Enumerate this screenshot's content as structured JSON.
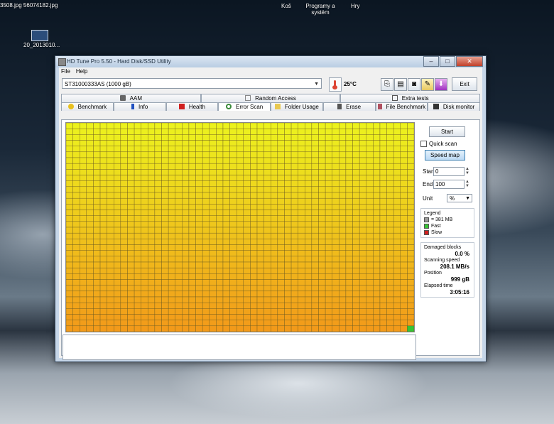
{
  "desktop": {
    "top_files": "3508.jpg   56074182.jpg",
    "top_items": [
      "Koš",
      "Programy a systém",
      "Hry"
    ],
    "icon_label": "20_2013010..."
  },
  "window": {
    "title": "HD Tune Pro 5.50 - Hard Disk/SSD Utility",
    "menu": [
      "File",
      "Help"
    ],
    "drive": "ST31000333AS (1000 gB)",
    "temperature": "25°C",
    "exit_label": "Exit",
    "toolbar_icons": [
      "copy-icon",
      "save-icon",
      "camera-icon",
      "options-icon",
      "download-icon"
    ]
  },
  "tabs": {
    "row1": [
      "AAM",
      "Random Access",
      "Extra tests"
    ],
    "row2": [
      "Benchmark",
      "Info",
      "Health",
      "Error Scan",
      "Folder Usage",
      "Erase",
      "File Benchmark",
      "Disk monitor"
    ],
    "active": "Error Scan"
  },
  "error_scan": {
    "start_label": "Start",
    "quick_scan_label": "Quick scan",
    "quick_scan_checked": false,
    "speed_map_label": "Speed map",
    "start_field_label": "Start",
    "start_value": "0",
    "end_field_label": "End",
    "end_value": "100",
    "unit_label": "Unit",
    "unit_value": "%",
    "legend_title": "Legend",
    "legend_block": "= 381 MB",
    "legend_fast": "Fast",
    "legend_slow": "Slow",
    "damaged_label": "Damaged blocks",
    "damaged_value": "0.0 %",
    "speed_label": "Scanning speed",
    "speed_value": "208.1 MB/s",
    "position_label": "Position",
    "position_value": "999 gB",
    "elapsed_label": "Elapsed time",
    "elapsed_value": "3:05:16",
    "grid": {
      "cols": 51,
      "rows": 36,
      "color_top": "#ecf21e",
      "color_bottom": "#f29a1a",
      "fast_color": "#36c436",
      "slow_color": "#d02020"
    }
  }
}
